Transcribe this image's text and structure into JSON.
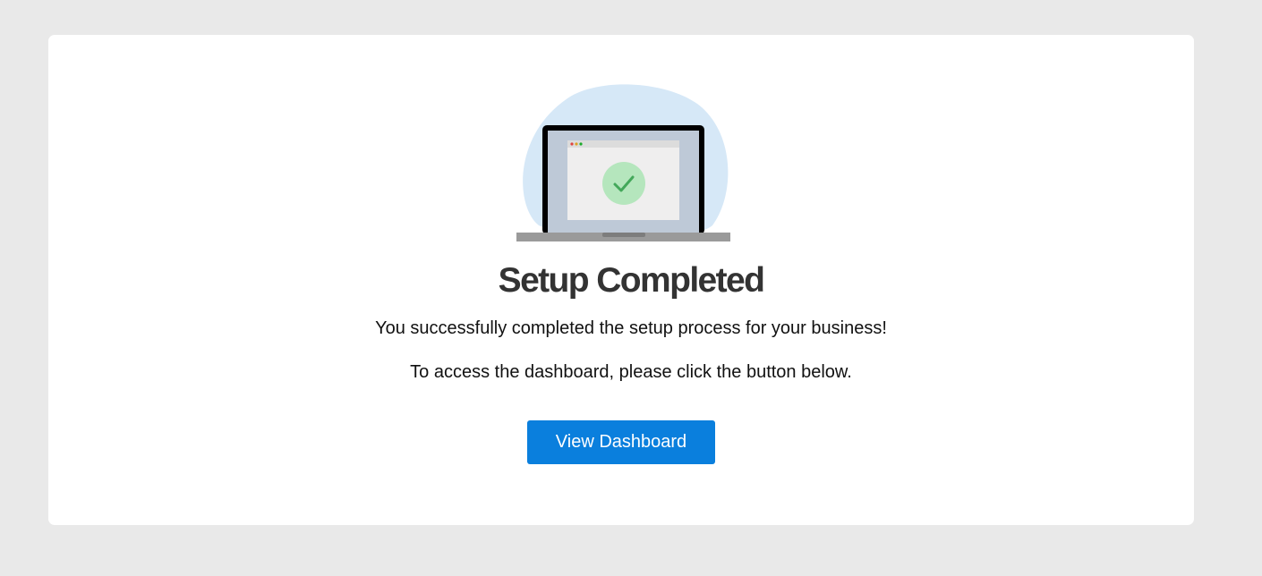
{
  "success": {
    "title": "Setup Completed",
    "message": "You successfully completed the setup process for your business!",
    "instruction": "To access the dashboard, please click the button below.",
    "button_label": "View Dashboard"
  },
  "colors": {
    "page_background": "#e9e9e9",
    "card_background": "#ffffff",
    "button": "#0a7fdd",
    "check_circle": "#b5e6bd",
    "check_mark": "#43a85a",
    "blob": "#d6e8f7"
  },
  "icons": {
    "illustration": "laptop-check-icon"
  }
}
